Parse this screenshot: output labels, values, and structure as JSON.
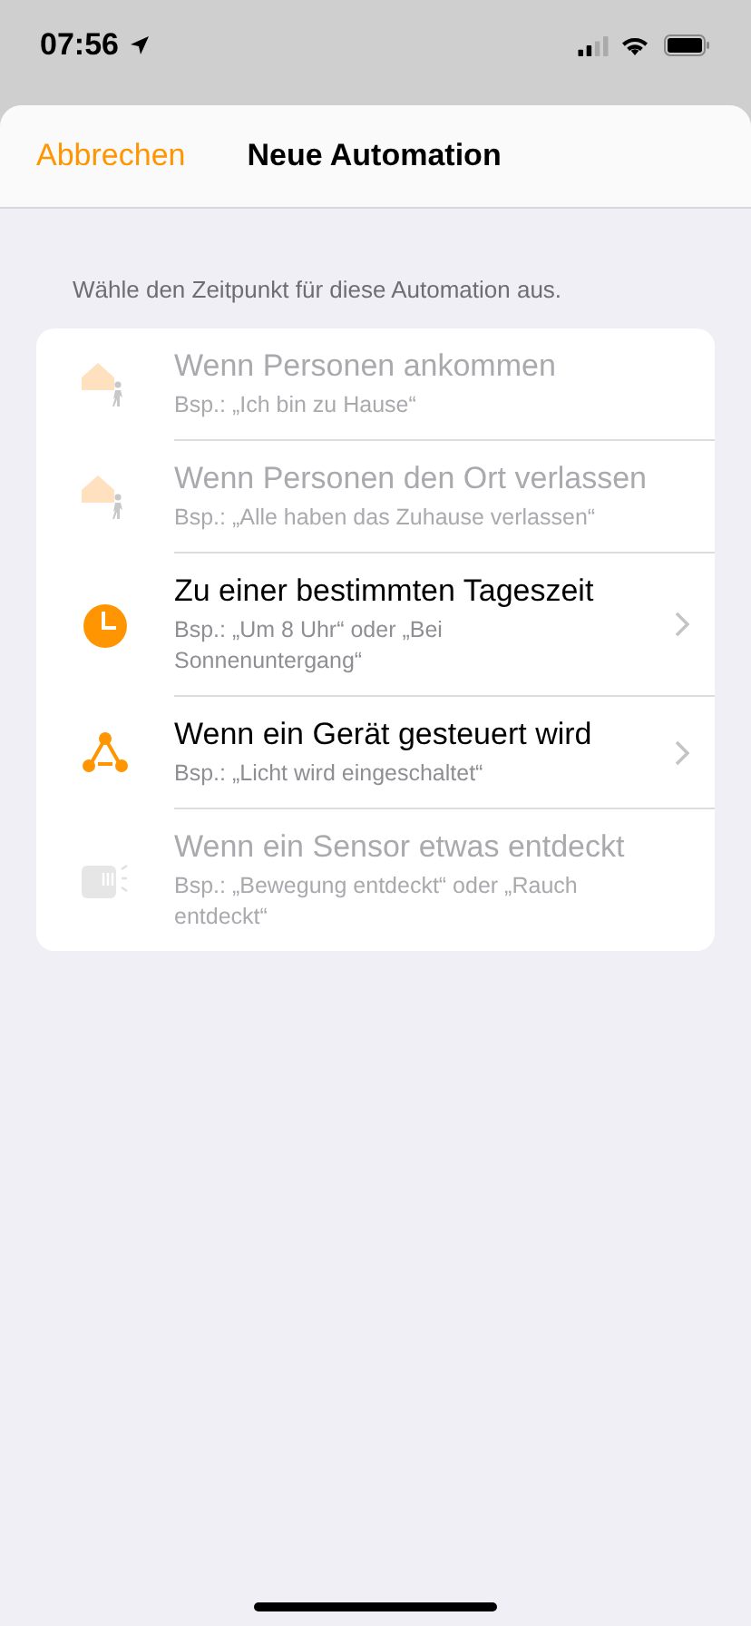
{
  "status_bar": {
    "time": "07:56"
  },
  "nav": {
    "cancel": "Abbrechen",
    "title": "Neue Automation"
  },
  "caption": "Wähle den Zeitpunkt für diese Automation aus.",
  "options": [
    {
      "kind": "arrive",
      "title": "Wenn Personen ankommen",
      "example": "Bsp.: „Ich bin zu Hause“",
      "disabled": true
    },
    {
      "kind": "leave",
      "title": "Wenn Personen den Ort verlassen",
      "example": "Bsp.: „Alle haben das Zuhause verlassen“",
      "disabled": true
    },
    {
      "kind": "time",
      "title": "Zu einer bestimmten Tageszeit",
      "example": "Bsp.: „Um 8 Uhr“ oder „Bei Sonnenuntergang“",
      "disabled": false
    },
    {
      "kind": "device",
      "title": "Wenn ein Gerät gesteuert wird",
      "example": "Bsp.: „Licht wird eingeschaltet“",
      "disabled": false
    },
    {
      "kind": "sensor",
      "title": "Wenn ein Sensor etwas entdeckt",
      "example": "Bsp.: „Bewegung entdeckt“ oder „Rauch entdeckt“",
      "disabled": true
    }
  ]
}
